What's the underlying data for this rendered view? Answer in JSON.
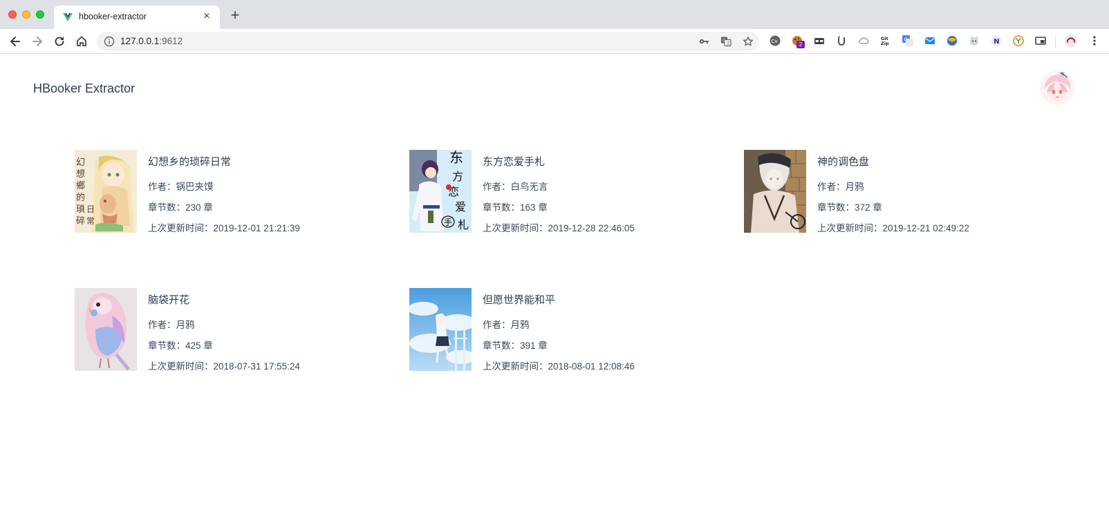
{
  "browser": {
    "tab_title": "hbooker-extractor",
    "url_host": "127.0.0.1",
    "url_port": ":9612",
    "extension_badge": "2"
  },
  "app": {
    "title": "HBooker Extractor"
  },
  "labels": {
    "author_prefix": "作者：",
    "chapters_prefix": "章节数：",
    "chapters_suffix": "章",
    "updated_prefix": "上次更新时间："
  },
  "books": [
    {
      "title": "幻想乡的琐碎日常",
      "author": "锅巴夹馍",
      "chapters": "230",
      "updated": "2019-12-01 21:21:39",
      "cover_text": "幻想鄉的瑣碎日常"
    },
    {
      "title": "东方恋爱手札",
      "author": "白鸟无言",
      "chapters": "163",
      "updated": "2019-12-28 22:46:05",
      "cover_text": "东方恋爱手札"
    },
    {
      "title": "神的调色盘",
      "author": "月鸦",
      "chapters": "372",
      "updated": "2019-12-21 02:49:22"
    },
    {
      "title": "脑袋开花",
      "author": "月鸦",
      "chapters": "425",
      "updated": "2018-07-31 17:55:24"
    },
    {
      "title": "但愿世界能和平",
      "author": "月鸦",
      "chapters": "391",
      "updated": "2018-08-01 12:08:46"
    }
  ],
  "icons": {
    "favicon": "vue-logo-icon",
    "back": "back-arrow-icon",
    "forward": "forward-arrow-icon",
    "reload": "reload-icon",
    "home": "home-icon",
    "info": "info-icon",
    "key": "key-icon",
    "translate": "translate-icon",
    "star": "star-icon"
  }
}
